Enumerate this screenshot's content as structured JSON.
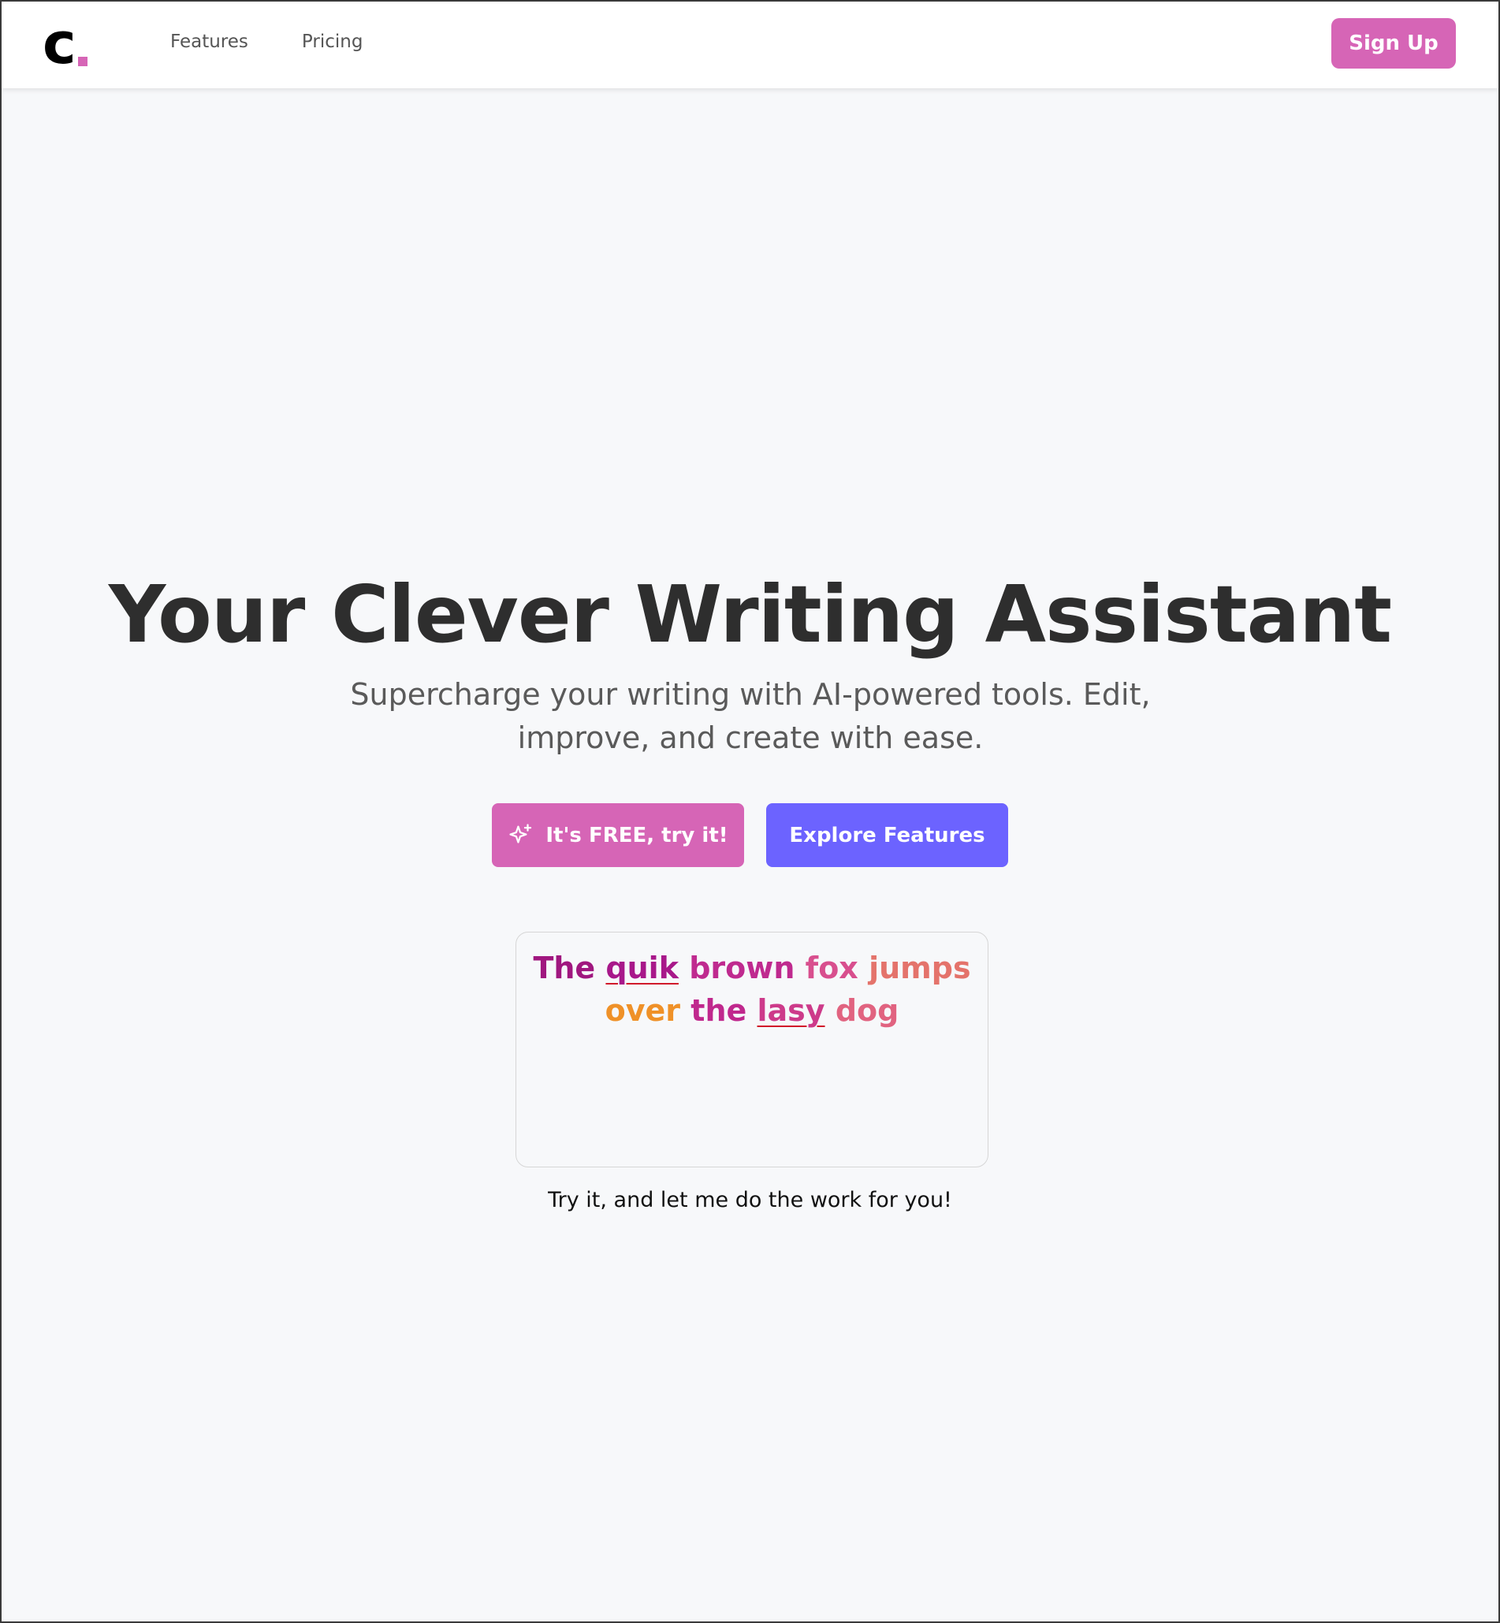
{
  "header": {
    "logo_letter": "c",
    "nav": [
      {
        "label": "Features"
      },
      {
        "label": "Pricing"
      }
    ],
    "signup_label": "Sign Up"
  },
  "hero": {
    "title": "Your Clever Writing Assistant",
    "subtitle": "Supercharge your writing with AI-powered tools. Edit, improve, and create with ease.",
    "cta_primary": "It's FREE, try it!",
    "cta_secondary": "Explore Features"
  },
  "demo": {
    "words": [
      {
        "text": "The",
        "color": "#a0177f",
        "misspelled": false
      },
      {
        "text": "quik",
        "color": "#a8188a",
        "misspelled": true
      },
      {
        "text": "brown",
        "color": "#bf2a8f",
        "misspelled": false
      },
      {
        "text": "fox",
        "color": "#d84f8e",
        "misspelled": false
      },
      {
        "text": "jumps",
        "color": "#e4736b",
        "misspelled": false
      },
      {
        "text": "over",
        "color": "#ef9128",
        "misspelled": false
      },
      {
        "text": "the",
        "color": "#c0288d",
        "misspelled": false
      },
      {
        "text": "lasy",
        "color": "#cd3a8a",
        "misspelled": true
      },
      {
        "text": "dog",
        "color": "#e16380",
        "misspelled": false
      }
    ],
    "caption": "Try it, and let me do the work for you!"
  },
  "colors": {
    "brand_pink": "#d665b6",
    "brand_purple": "#6c63ff",
    "background": "#f7f8fa",
    "title": "#2e2e2e"
  },
  "icons": {
    "cta_primary_icon": "sparkle-icon"
  }
}
